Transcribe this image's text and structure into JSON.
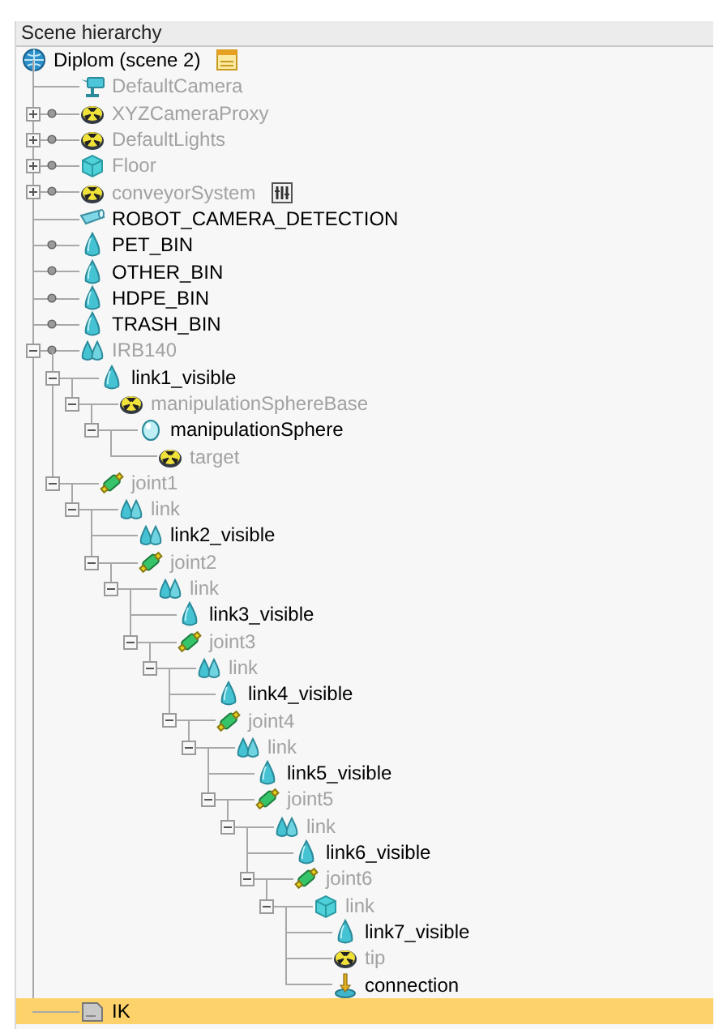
{
  "panel": {
    "title": "Scene hierarchy"
  },
  "tree": {
    "label": "Diplom (scene 2)",
    "kind": "scene",
    "dimmed": false,
    "selected": false,
    "has_properties": true,
    "children": [
      {
        "label": "DefaultCamera",
        "kind": "camera",
        "dimmed": true,
        "dot": false,
        "selected": false
      },
      {
        "label": "XYZCameraProxy",
        "kind": "dummy",
        "dimmed": true,
        "dot": true,
        "expanded": false,
        "selected": false
      },
      {
        "label": "DefaultLights",
        "kind": "dummy",
        "dimmed": true,
        "dot": true,
        "expanded": false,
        "selected": false
      },
      {
        "label": "Floor",
        "kind": "cube",
        "dimmed": true,
        "dot": true,
        "expanded": false,
        "selected": false
      },
      {
        "label": "conveyorSystem",
        "kind": "dummy",
        "dimmed": true,
        "dot": true,
        "expanded": false,
        "selected": false,
        "has_script": true
      },
      {
        "label": "ROBOT_CAMERA_DETECTION",
        "kind": "vision",
        "dimmed": false,
        "dot": false,
        "selected": false
      },
      {
        "label": "PET_BIN",
        "kind": "shape",
        "dimmed": false,
        "dot": true,
        "selected": false
      },
      {
        "label": "OTHER_BIN",
        "kind": "shape",
        "dimmed": false,
        "dot": true,
        "selected": false
      },
      {
        "label": "HDPE_BIN",
        "kind": "shape",
        "dimmed": false,
        "dot": true,
        "selected": false
      },
      {
        "label": "TRASH_BIN",
        "kind": "shape",
        "dimmed": false,
        "dot": true,
        "selected": false
      },
      {
        "label": "IRB140",
        "kind": "multishape",
        "dimmed": true,
        "dot": true,
        "expanded": true,
        "selected": false,
        "children": [
          {
            "label": "link1_visible",
            "kind": "shape",
            "dimmed": false,
            "expanded": true,
            "selected": false,
            "children": [
              {
                "label": "manipulationSphereBase",
                "kind": "dummy",
                "dimmed": true,
                "expanded": true,
                "selected": false,
                "children": [
                  {
                    "label": "manipulationSphere",
                    "kind": "sphere",
                    "dimmed": false,
                    "expanded": true,
                    "selected": false,
                    "children": [
                      {
                        "label": "target",
                        "kind": "dummy",
                        "dimmed": true,
                        "selected": false
                      }
                    ]
                  }
                ]
              }
            ]
          },
          {
            "label": "joint1",
            "kind": "joint",
            "dimmed": true,
            "expanded": true,
            "selected": false,
            "children": [
              {
                "label": "link",
                "kind": "multishape",
                "dimmed": true,
                "expanded": true,
                "selected": false,
                "children": [
                  {
                    "label": "link2_visible",
                    "kind": "multishape",
                    "dimmed": false,
                    "selected": false
                  },
                  {
                    "label": "joint2",
                    "kind": "joint",
                    "dimmed": true,
                    "expanded": true,
                    "selected": false,
                    "children": [
                      {
                        "label": "link",
                        "kind": "multishape",
                        "dimmed": true,
                        "expanded": true,
                        "selected": false,
                        "children": [
                          {
                            "label": "link3_visible",
                            "kind": "shape",
                            "dimmed": false,
                            "selected": false
                          },
                          {
                            "label": "joint3",
                            "kind": "joint",
                            "dimmed": true,
                            "expanded": true,
                            "selected": false,
                            "children": [
                              {
                                "label": "link",
                                "kind": "multishape",
                                "dimmed": true,
                                "expanded": true,
                                "selected": false,
                                "children": [
                                  {
                                    "label": "link4_visible",
                                    "kind": "shape",
                                    "dimmed": false,
                                    "selected": false
                                  },
                                  {
                                    "label": "joint4",
                                    "kind": "joint",
                                    "dimmed": true,
                                    "expanded": true,
                                    "selected": false,
                                    "children": [
                                      {
                                        "label": "link",
                                        "kind": "multishape",
                                        "dimmed": true,
                                        "expanded": true,
                                        "selected": false,
                                        "children": [
                                          {
                                            "label": "link5_visible",
                                            "kind": "shape",
                                            "dimmed": false,
                                            "selected": false
                                          },
                                          {
                                            "label": "joint5",
                                            "kind": "joint",
                                            "dimmed": true,
                                            "expanded": true,
                                            "selected": false,
                                            "children": [
                                              {
                                                "label": "link",
                                                "kind": "multishape",
                                                "dimmed": true,
                                                "expanded": true,
                                                "selected": false,
                                                "children": [
                                                  {
                                                    "label": "link6_visible",
                                                    "kind": "shape",
                                                    "dimmed": false,
                                                    "selected": false
                                                  },
                                                  {
                                                    "label": "joint6",
                                                    "kind": "joint",
                                                    "dimmed": true,
                                                    "expanded": true,
                                                    "selected": false,
                                                    "children": [
                                                      {
                                                        "label": "link",
                                                        "kind": "cube",
                                                        "dimmed": true,
                                                        "expanded": true,
                                                        "selected": false,
                                                        "children": [
                                                          {
                                                            "label": "link7_visible",
                                                            "kind": "shape",
                                                            "dimmed": false,
                                                            "selected": false
                                                          },
                                                          {
                                                            "label": "tip",
                                                            "kind": "dummy",
                                                            "dimmed": true,
                                                            "selected": false
                                                          },
                                                          {
                                                            "label": "connection",
                                                            "kind": "force",
                                                            "dimmed": false,
                                                            "selected": false
                                                          }
                                                        ]
                                                      }
                                                    ]
                                                  }
                                                ]
                                              }
                                            ]
                                          }
                                        ]
                                      }
                                    ]
                                  }
                                ]
                              }
                            ]
                          }
                        ]
                      }
                    ]
                  }
                ]
              }
            ]
          }
        ]
      },
      {
        "label": "IK",
        "kind": "ik",
        "dimmed": false,
        "dot": false,
        "selected": true
      }
    ]
  }
}
